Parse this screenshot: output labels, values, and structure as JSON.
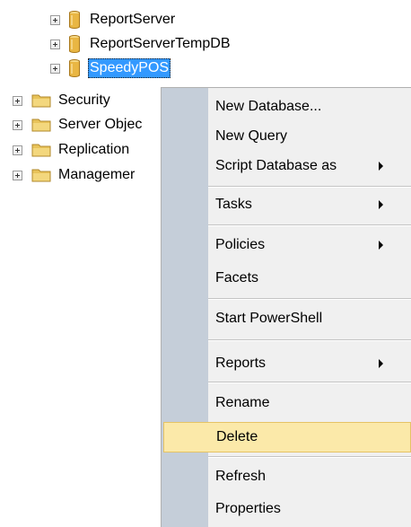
{
  "tree": {
    "databases": [
      {
        "label": "ReportServer",
        "selected": false
      },
      {
        "label": "ReportServerTempDB",
        "selected": false
      },
      {
        "label": "SpeedyPOS",
        "selected": true
      }
    ],
    "folders": [
      {
        "label": "Security"
      },
      {
        "label": "Server Objec"
      },
      {
        "label": "Replication"
      },
      {
        "label": "Managemer"
      }
    ]
  },
  "context_menu": {
    "items": [
      {
        "label": "New Database...",
        "submenu": false
      },
      {
        "label": "New Query",
        "submenu": false
      },
      {
        "label": "Script Database as",
        "submenu": true
      },
      {
        "label": "Tasks",
        "submenu": true
      },
      {
        "label": "Policies",
        "submenu": true
      },
      {
        "label": "Facets",
        "submenu": false
      },
      {
        "label": "Start PowerShell",
        "submenu": false
      },
      {
        "label": "Reports",
        "submenu": true
      },
      {
        "label": "Rename",
        "submenu": false
      },
      {
        "label": "Delete",
        "submenu": false,
        "highlighted": true
      },
      {
        "label": "Refresh",
        "submenu": false
      },
      {
        "label": "Properties",
        "submenu": false
      }
    ]
  },
  "colors": {
    "selection_bg": "#3399ff",
    "menu_gutter": "#c5ced9",
    "menu_bg": "#f0f0f0",
    "menu_hover_bg": "#fbe9a9",
    "menu_hover_border": "#e5c365",
    "folder_yellow": "#e8c35a",
    "db_gold": "#e9b643"
  }
}
